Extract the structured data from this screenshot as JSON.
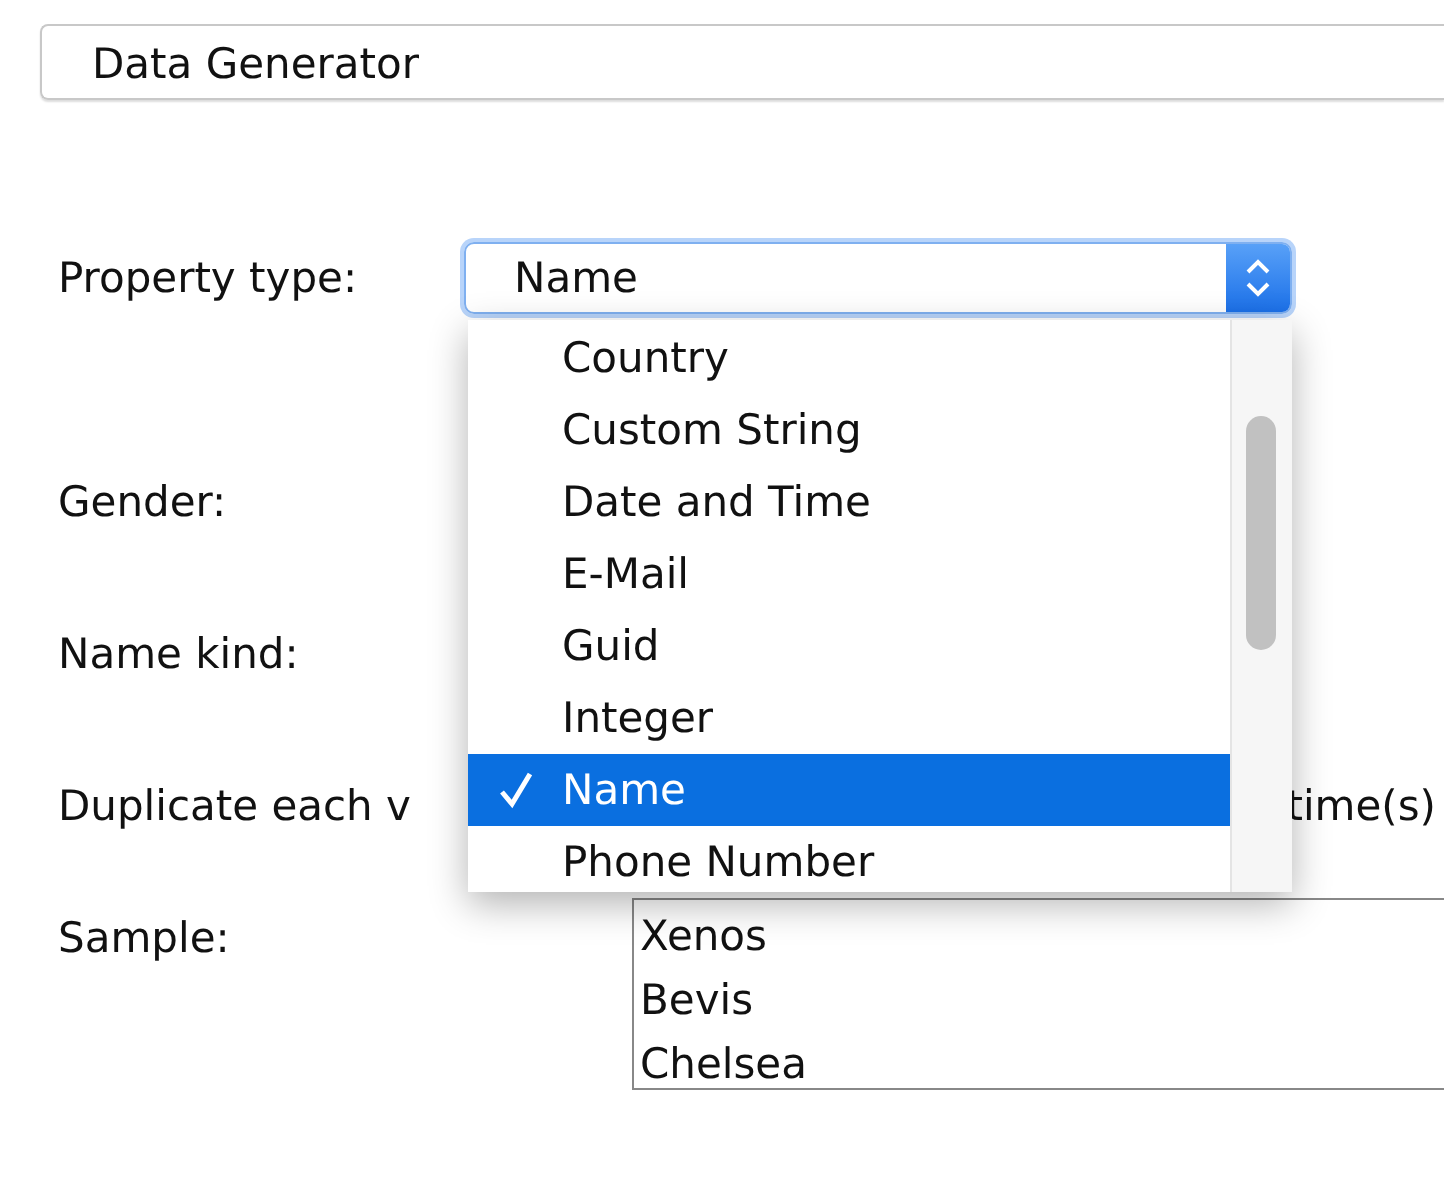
{
  "title": "Data Generator",
  "fields": [
    {
      "kind": "combo",
      "label": "Property type:",
      "value": "Name"
    },
    {
      "kind": "plain",
      "label": "Gender:"
    },
    {
      "kind": "plain",
      "label": "Name kind:"
    },
    {
      "kind": "plain",
      "label": "Duplicate each v",
      "suffix": "time(s)"
    },
    {
      "kind": "sample",
      "label": "Sample:",
      "lines": [
        "Xenos",
        "Bevis",
        "Chelsea"
      ]
    }
  ],
  "dropdown": {
    "items": [
      {
        "label": "Country",
        "selected": false
      },
      {
        "label": "Custom String",
        "selected": false
      },
      {
        "label": "Date and Time",
        "selected": false
      },
      {
        "label": "E-Mail",
        "selected": false
      },
      {
        "label": "Guid",
        "selected": false
      },
      {
        "label": "Integer",
        "selected": false
      },
      {
        "label": "Name",
        "selected": true
      },
      {
        "label": "Phone Number",
        "selected": false
      }
    ]
  }
}
